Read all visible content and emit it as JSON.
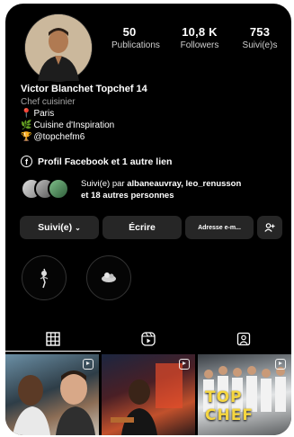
{
  "profile": {
    "name": "Victor Blanchet Topchef 14",
    "category": "Chef cuisinier",
    "bio": [
      {
        "icon": "pin-icon",
        "text": "Paris"
      },
      {
        "icon": "leaf-icon",
        "text": "Cuisine d'Inspiration"
      },
      {
        "icon": "trophy-icon",
        "text": "@topchefm6"
      }
    ]
  },
  "stats": [
    {
      "value": "50",
      "label": "Publications"
    },
    {
      "value": "10,8 K",
      "label": "Followers"
    },
    {
      "value": "753",
      "label": "Suivi(e)s"
    }
  ],
  "link": {
    "icon": "facebook-icon",
    "text": "Profil Facebook et 1 autre lien"
  },
  "followed_by": {
    "prefix": "Suivi(e) par ",
    "names": "albaneauvray, leo_renusson",
    "suffix": "et 18 autres personnes"
  },
  "buttons": {
    "follow": "Suivi(e)",
    "write": "Écrire",
    "email": "Adresse e-m...",
    "add_user": "+"
  },
  "tabs": [
    {
      "icon": "grid-icon"
    },
    {
      "icon": "reels-icon"
    },
    {
      "icon": "tagged-icon"
    }
  ],
  "posts": [
    {
      "overlay": ""
    },
    {
      "overlay": ""
    },
    {
      "overlay": "TOP CHEF"
    }
  ]
}
